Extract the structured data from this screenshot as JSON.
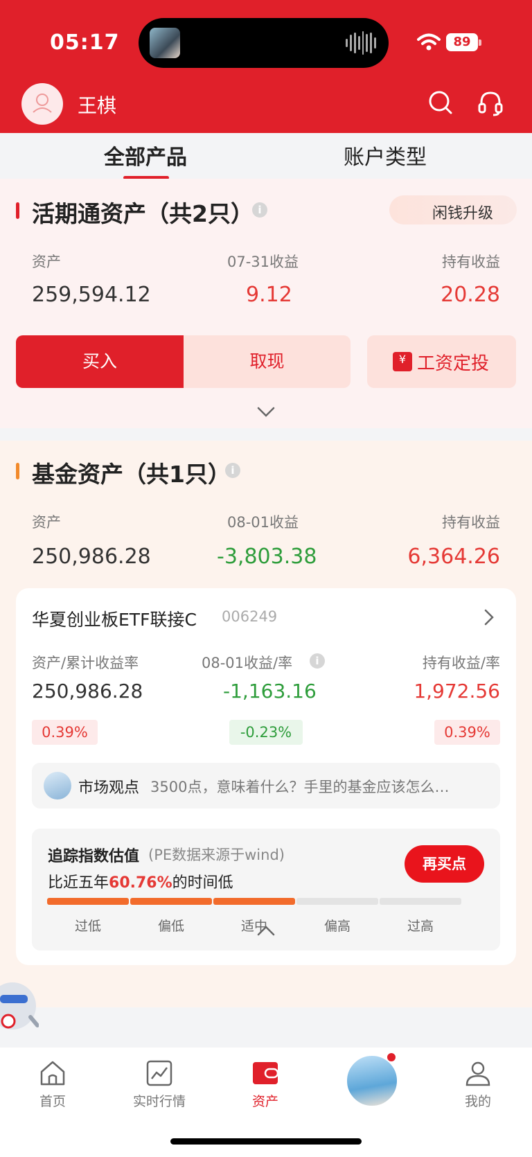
{
  "status_bar": {
    "time": "05:17",
    "battery": "89"
  },
  "header": {
    "user_name": "王棋"
  },
  "tabs": [
    {
      "label": "全部产品",
      "active": true
    },
    {
      "label": "账户类型",
      "active": false
    }
  ],
  "current_section": {
    "title": "活期通资产（共2只）",
    "upgrade_label": "闲钱升级",
    "stats": [
      {
        "label": "资产",
        "value": "259,594.12"
      },
      {
        "label": "07-31收益",
        "value": "9.12"
      },
      {
        "label": "持有收益",
        "value": "20.28"
      }
    ],
    "buy_label": "买入",
    "withdraw_label": "取现",
    "salary_label": "工资定投"
  },
  "fund_section": {
    "title": "基金资产（共1只）",
    "stats": [
      {
        "label": "资产",
        "value": "250,986.28"
      },
      {
        "label": "08-01收益",
        "value": "-3,803.38"
      },
      {
        "label": "持有收益",
        "value": "6,364.26"
      }
    ],
    "fund": {
      "name": "华夏创业板ETF联接C",
      "code": "006249",
      "col1_label": "资产/累计收益率",
      "col1_value": "250,986.28",
      "col1_rate": "0.39%",
      "col2_label": "08-01收益/率",
      "col2_value": "-1,163.16",
      "col2_rate": "-0.23%",
      "col3_label": "持有收益/率",
      "col3_value": "1,972.56",
      "col3_rate": "0.39%"
    },
    "news": {
      "label": "市场观点",
      "text": "3500点，意味着什么？手里的基金应该怎么…"
    },
    "valuation": {
      "title": "追踪指数估值",
      "note": "(PE数据来源于wind)",
      "sub_prefix": "比近五年",
      "sub_pct": "60.76%",
      "sub_suffix": "的时间低",
      "button": "再买点",
      "level": "适中",
      "segments": [
        {
          "label": "过低",
          "filled": true
        },
        {
          "label": "偏低",
          "filled": true
        },
        {
          "label": "适中",
          "filled": true
        },
        {
          "label": "偏高",
          "filled": false
        },
        {
          "label": "过高",
          "filled": false
        }
      ]
    }
  },
  "bottom_nav": [
    {
      "label": "首页",
      "icon": "home-icon"
    },
    {
      "label": "实时行情",
      "icon": "chart-icon"
    },
    {
      "label": "资产",
      "icon": "wallet-icon",
      "active": true
    },
    {
      "label": "我的",
      "icon": "person-icon"
    }
  ],
  "colors": {
    "brand_red": "#e0202a",
    "gain": "#e53935",
    "loss": "#2e9d3b",
    "segment_on": "#f26b2b",
    "segment_off": "#e3e3e3"
  }
}
